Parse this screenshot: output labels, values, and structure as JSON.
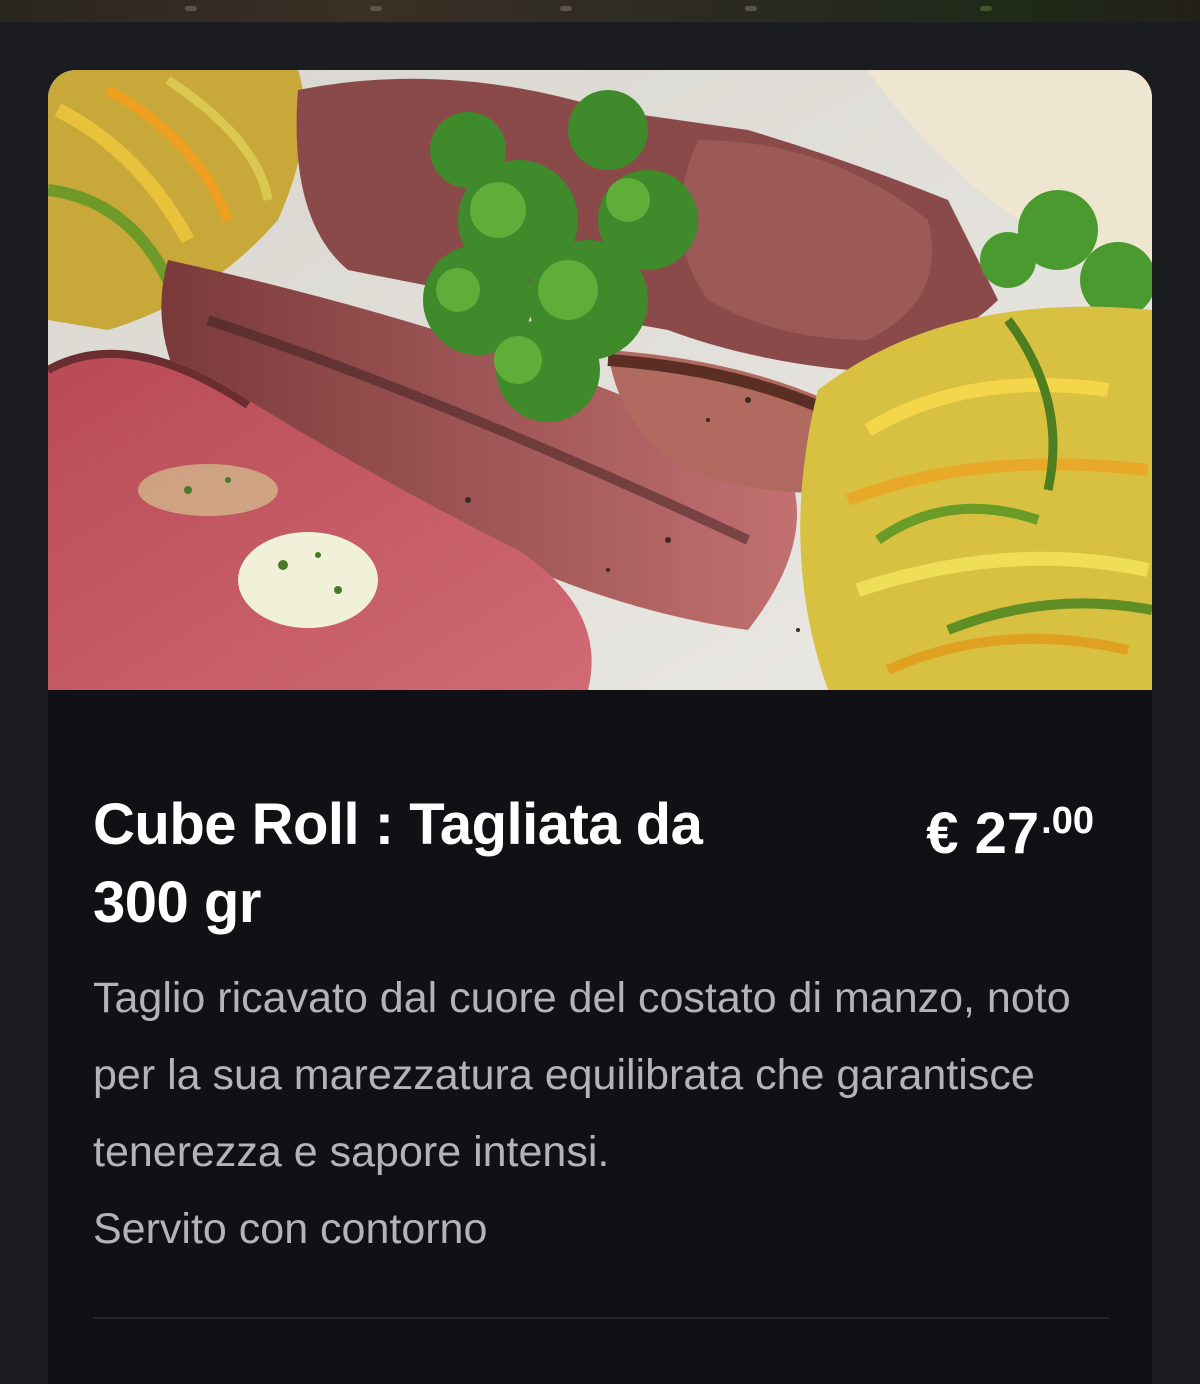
{
  "menu_item": {
    "title": "Cube Roll : Tagliata da 300 gr",
    "price": {
      "currency_symbol": "€",
      "main": "27",
      "cents": ".00"
    },
    "description": "Taglio ricavato dal cuore del costato di manzo, noto per la sua marezzatura equilibrata che garantisce tenerezza e sapore intensi.",
    "note": "Servito con contorno"
  },
  "colors": {
    "page_background": "#1b1c20",
    "card_background": "#111115",
    "title_text": "#ffffff",
    "description_text": "#b3b3b8"
  }
}
